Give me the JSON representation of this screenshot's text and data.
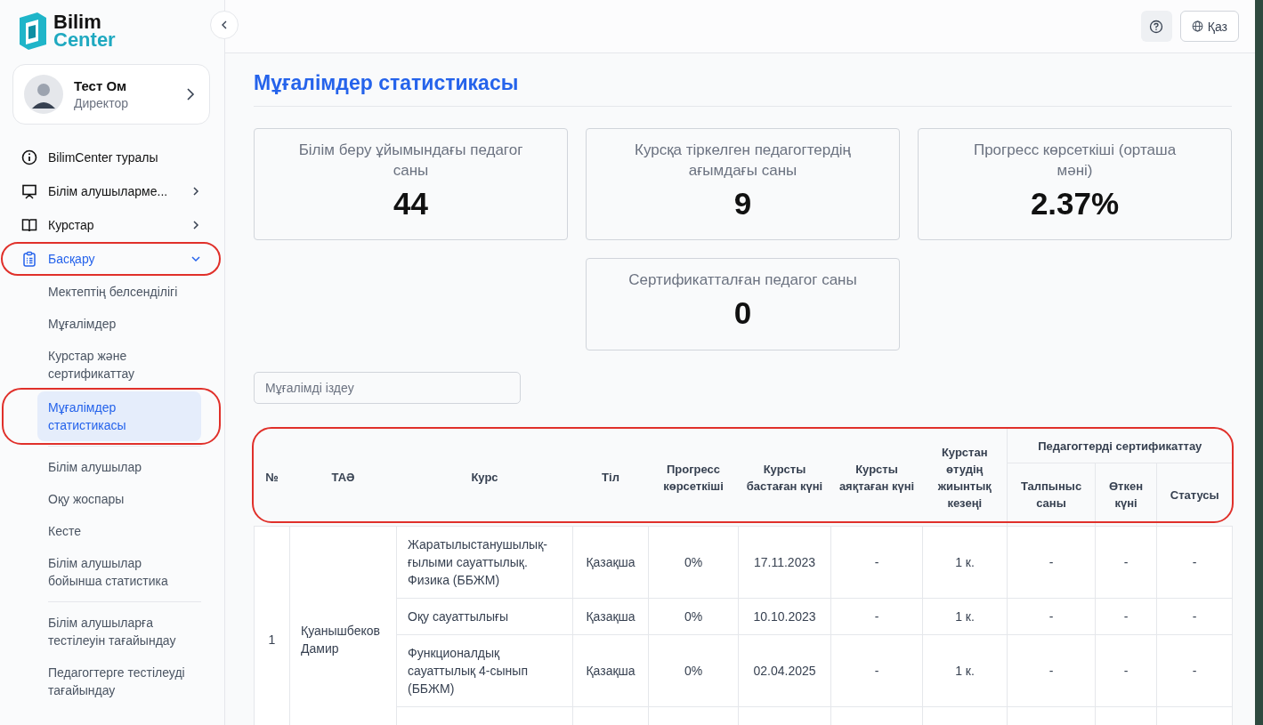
{
  "logo": {
    "line1": "Bilim",
    "line2": "Center"
  },
  "user": {
    "name": "Тест Ом",
    "role": "Директор"
  },
  "nav": [
    {
      "label": "BilimCenter туралы",
      "expandable": false,
      "expanded": false,
      "highlighted": false
    },
    {
      "label": "Білім алушыларме...",
      "expandable": true,
      "expanded": false,
      "highlighted": false
    },
    {
      "label": "Курстар",
      "expandable": true,
      "expanded": false,
      "highlighted": false
    },
    {
      "label": "Басқару",
      "expandable": true,
      "expanded": true,
      "highlighted": true,
      "groups": [
        {
          "items": [
            {
              "label": "Мектептің белсенділігі",
              "selected": false,
              "highlighted": false
            },
            {
              "label": "Мұғалімдер",
              "selected": false,
              "highlighted": false
            },
            {
              "label": "Курстар және сертификаттау",
              "selected": false,
              "highlighted": false
            },
            {
              "label": "Мұғалімдер статистикасы",
              "selected": true,
              "highlighted": true
            }
          ]
        },
        {
          "items": [
            {
              "label": "Білім алушылар",
              "selected": false,
              "highlighted": false
            },
            {
              "label": "Оқу жоспары",
              "selected": false,
              "highlighted": false
            },
            {
              "label": "Кесте",
              "selected": false,
              "highlighted": false
            },
            {
              "label": "Білім алушылар бойынша статистика",
              "selected": false,
              "highlighted": false
            }
          ]
        },
        {
          "items": [
            {
              "label": "Білім алушыларға тестілеуін тағайындау",
              "selected": false,
              "highlighted": false
            },
            {
              "label": "Педагогтерге тестілеуді тағайындау",
              "selected": false,
              "highlighted": false
            }
          ]
        }
      ]
    }
  ],
  "header": {
    "language": "Қаз"
  },
  "page_title": "Мұғалімдер статистикасы",
  "stats": [
    {
      "label": "Білім беру ұйымындағы педагог саны",
      "value": "44"
    },
    {
      "label": "Курсқа тіркелген педагогтердің ағымдағы саны",
      "value": "9"
    },
    {
      "label": "Прогресс көрсеткіші (орташа мәні)",
      "value": "2.37%"
    },
    {
      "label": "Сертификатталған педагог саны",
      "value": "0"
    }
  ],
  "search": {
    "placeholder": "Мұғалімді іздеу"
  },
  "table": {
    "header_highlighted": true,
    "columns": [
      "№",
      "ТАӘ",
      "Курс",
      "Тіл",
      "Прогресс көрсеткіші",
      "Курсты бастаған күні",
      "Курсты аяқтаған күні",
      "Курстан өтудің жиынтық кезеңі"
    ],
    "group_column": "Педагогтерді сертификаттау",
    "sub_columns": [
      "Талпыныс саны",
      "Өткен күні",
      "Статусы"
    ],
    "rows": [
      {
        "number": "1",
        "name": "Қуанышбеков Дамир",
        "courses": [
          {
            "cells": [
              "Жаратылыстанушылық-ғылыми сауаттылық. Физика (ББЖМ)",
              "Қазақша",
              "0%",
              "17.11.2023",
              "-",
              "1 к.",
              "-",
              "-",
              "-"
            ]
          },
          {
            "cells": [
              "Оқу сауаттылығы",
              "Қазақша",
              "0%",
              "10.10.2023",
              "-",
              "1 к.",
              "-",
              "-",
              "-"
            ]
          },
          {
            "cells": [
              "Функционалдық сауаттылық 4-сынып (ББЖМ)",
              "Қазақша",
              "0%",
              "02.04.2025",
              "-",
              "1 к.",
              "-",
              "-",
              "-"
            ]
          }
        ]
      }
    ]
  }
}
